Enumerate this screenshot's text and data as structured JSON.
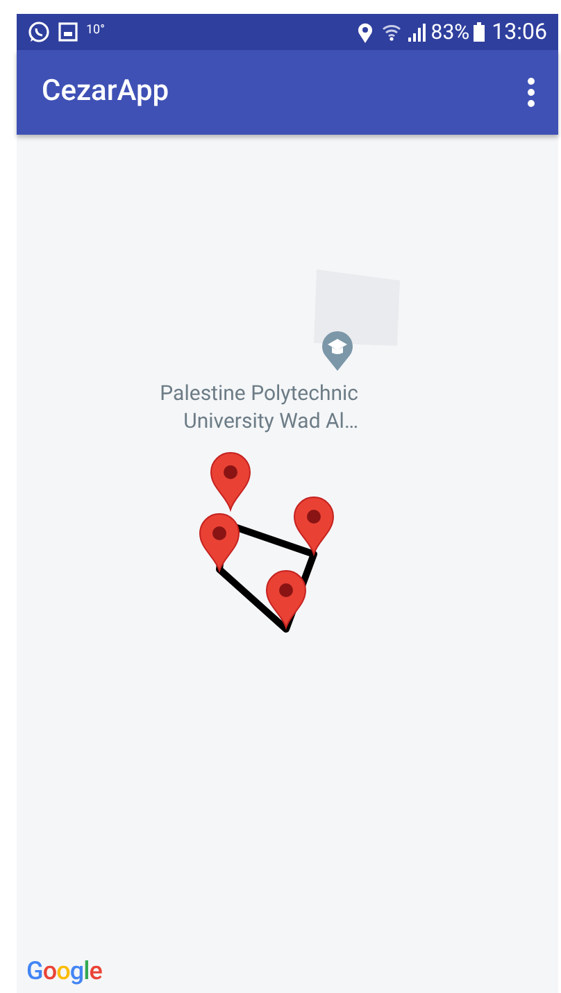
{
  "status_bar": {
    "notification_text": "10°",
    "battery": "83%",
    "time": "13:06"
  },
  "app_bar": {
    "title": "CezarApp"
  },
  "map": {
    "place_label": [
      "Palestine Polytechnic",
      "University Wad Al…"
    ],
    "attribution": "Google"
  }
}
